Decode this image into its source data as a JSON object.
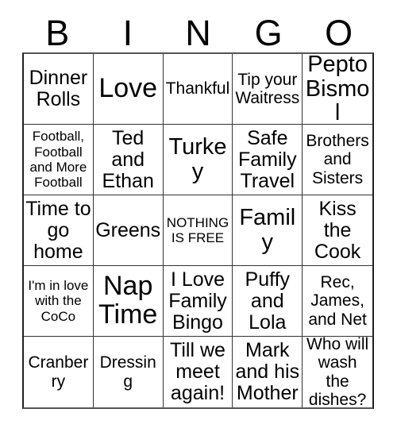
{
  "card": {
    "title": "Bingo Card",
    "header_letters": [
      "B",
      "I",
      "N",
      "G",
      "O"
    ],
    "columns": 5,
    "rows": 5,
    "grid_line_color": "#333333",
    "background_color": "#ffffff",
    "text_color": "#000000",
    "cells": [
      [
        {
          "text": "Dinner Rolls",
          "size": "lg"
        },
        {
          "text": "Love",
          "size": "xxl"
        },
        {
          "text": "Thankful",
          "size": "md"
        },
        {
          "text": "Tip your Waitress",
          "size": "md"
        },
        {
          "text": "Pepto Bismol",
          "size": "xl"
        }
      ],
      [
        {
          "text": "Football, Football and More Football",
          "size": "sm"
        },
        {
          "text": "Ted and Ethan",
          "size": "lg"
        },
        {
          "text": "Turkey",
          "size": "xl"
        },
        {
          "text": "Safe Family Travel",
          "size": "lg"
        },
        {
          "text": "Brothers and Sisters",
          "size": "md"
        }
      ],
      [
        {
          "text": "Time to go home",
          "size": "lg"
        },
        {
          "text": "Greens",
          "size": "lg"
        },
        {
          "text": "NOTHING IS FREE",
          "size": "sm"
        },
        {
          "text": "Family",
          "size": "xl"
        },
        {
          "text": "Kiss the Cook",
          "size": "lg"
        }
      ],
      [
        {
          "text": "I'm in love with the CoCo",
          "size": "sm"
        },
        {
          "text": "Nap Time",
          "size": "xxl"
        },
        {
          "text": "I Love Family Bingo",
          "size": "lg"
        },
        {
          "text": "Puffy and Lola",
          "size": "lg"
        },
        {
          "text": "Rec, James, and Net",
          "size": "md"
        }
      ],
      [
        {
          "text": "Cranberry",
          "size": "md"
        },
        {
          "text": "Dressing",
          "size": "md"
        },
        {
          "text": "Till we meet again!",
          "size": "lg"
        },
        {
          "text": "Mark and his Mother",
          "size": "lg"
        },
        {
          "text": "Who will wash the dishes?",
          "size": "md"
        }
      ]
    ]
  }
}
